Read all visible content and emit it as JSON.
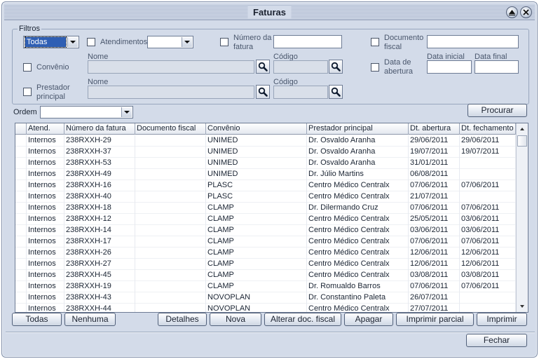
{
  "window": {
    "title": "Faturas"
  },
  "filters": {
    "legend": "Filtros",
    "tipo_select_value": "Todas",
    "atendimentos_label": "Atendimentos",
    "atendimentos_value": "",
    "numero_fatura_label_1": "Número da",
    "numero_fatura_label_2": "fatura",
    "numero_fatura_value": "",
    "documento_fiscal_label_1": "Documento",
    "documento_fiscal_label_2": "fiscal",
    "documento_fiscal_value": "",
    "convenio_label": "Convênio",
    "convenio_nome_label": "Nome",
    "convenio_codigo_label": "Código",
    "data_abertura_label_1": "Data de",
    "data_abertura_label_2": "abertura",
    "data_inicial_label": "Data inicial",
    "data_final_label": "Data final",
    "prestador_label_1": "Prestador",
    "prestador_label_2": "principal",
    "prestador_nome_label": "Nome",
    "prestador_codigo_label": "Código"
  },
  "ordem": {
    "label": "Ordem",
    "value": ""
  },
  "buttons": {
    "procurar": "Procurar",
    "todas": "Todas",
    "nenhuma": "Nenhuma",
    "detalhes": "Detalhes",
    "nova": "Nova",
    "alterar_doc_fiscal": "Alterar doc. fiscal",
    "apagar": "Apagar",
    "imprimir_parcial": "Imprimir parcial",
    "imprimir": "Imprimir",
    "fechar": "Fechar"
  },
  "table": {
    "columns": [
      "Atend.",
      "Número da fatura",
      "Documento fiscal",
      "Convênio",
      "Prestador principal",
      "Dt. abertura",
      "Dt. fechamento"
    ],
    "rows": [
      [
        "Internos",
        "238RXXH-29",
        "",
        "UNIMED",
        "Dr. Osvaldo Aranha",
        "29/06/2011",
        "29/06/2011"
      ],
      [
        "Internos",
        "238RXXH-37",
        "",
        "UNIMED",
        "Dr. Osvaldo Aranha",
        "19/07/2011",
        "19/07/2011"
      ],
      [
        "Internos",
        "238RXXH-53",
        "",
        "UNIMED",
        "Dr. Osvaldo Aranha",
        "31/01/2011",
        ""
      ],
      [
        "Internos",
        "238RXXH-49",
        "",
        "UNIMED",
        "Dr. Júlio Martins",
        "06/08/2011",
        ""
      ],
      [
        "Internos",
        "238RXXH-16",
        "",
        "PLASC",
        "Centro Médico Centralx",
        "07/06/2011",
        "07/06/2011"
      ],
      [
        "Internos",
        "238RXXH-40",
        "",
        "PLASC",
        "Centro Médico Centralx",
        "21/07/2011",
        ""
      ],
      [
        "Internos",
        "238RXXH-18",
        "",
        "CLAMP",
        "Dr. Dilermando Cruz",
        "07/06/2011",
        "07/06/2011"
      ],
      [
        "Internos",
        "238RXXH-12",
        "",
        "CLAMP",
        "Centro Médico Centralx",
        "25/05/2011",
        "03/06/2011"
      ],
      [
        "Internos",
        "238RXXH-14",
        "",
        "CLAMP",
        "Centro Médico Centralx",
        "03/06/2011",
        "03/06/2011"
      ],
      [
        "Internos",
        "238RXXH-17",
        "",
        "CLAMP",
        "Centro Médico Centralx",
        "07/06/2011",
        "07/06/2011"
      ],
      [
        "Internos",
        "238RXXH-26",
        "",
        "CLAMP",
        "Centro Médico Centralx",
        "12/06/2011",
        "12/06/2011"
      ],
      [
        "Internos",
        "238RXXH-27",
        "",
        "CLAMP",
        "Centro Médico Centralx",
        "12/06/2011",
        "12/06/2011"
      ],
      [
        "Internos",
        "238RXXH-45",
        "",
        "CLAMP",
        "Centro Médico Centralx",
        "03/08/2011",
        "03/08/2011"
      ],
      [
        "Internos",
        "238RXXH-19",
        "",
        "CLAMP",
        "Dr. Romualdo Barros",
        "07/06/2011",
        "07/06/2011"
      ],
      [
        "Internos",
        "238RXXH-43",
        "",
        "NOVOPLAN",
        "Dr. Constantino Paleta",
        "26/07/2011",
        ""
      ],
      [
        "Internos",
        "238RXXH-44",
        "",
        "NOVOPLAN",
        "Centro Médico Centralx",
        "27/07/2011",
        ""
      ]
    ]
  },
  "icons": {
    "minimize": "up-arrow-circle-icon",
    "close": "close-circle-icon",
    "lookup": "magnifier-icon",
    "dropdown": "chevron-down-icon"
  }
}
